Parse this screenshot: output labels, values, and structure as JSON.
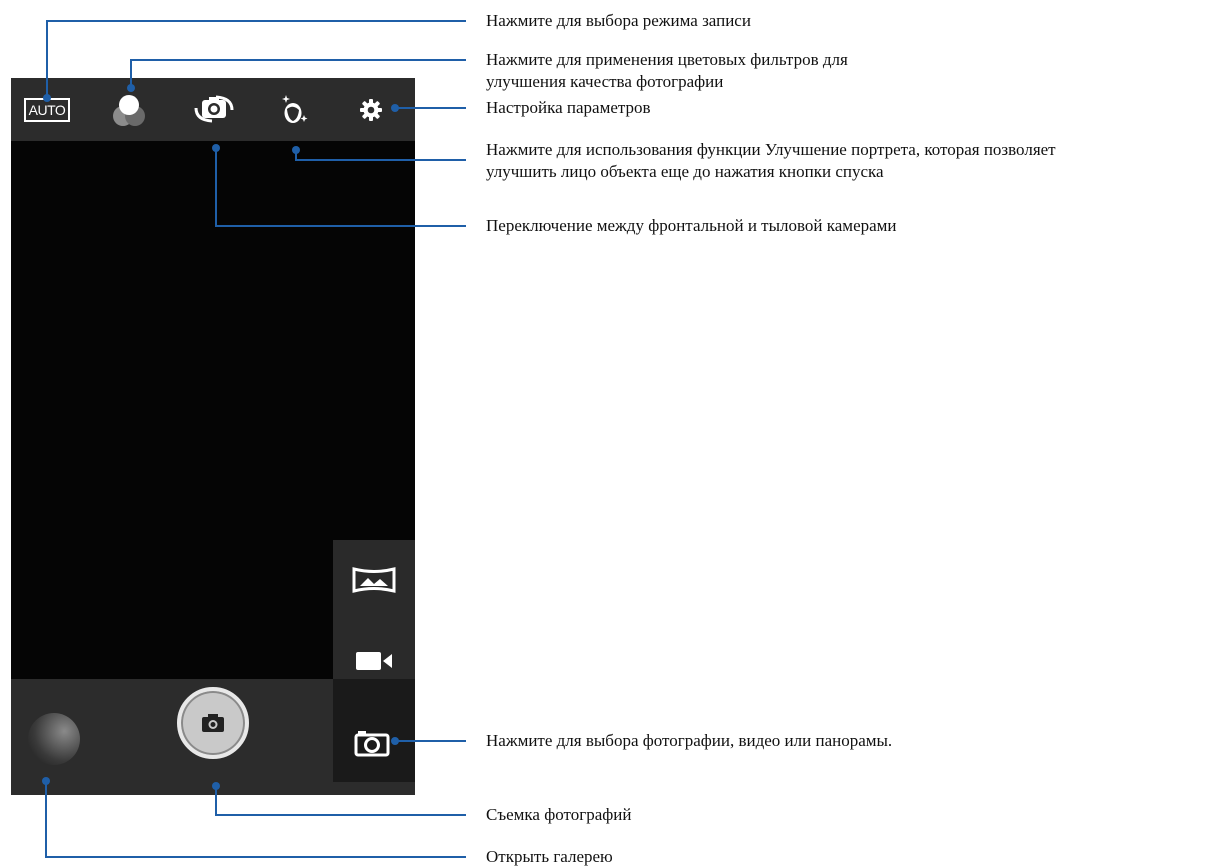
{
  "toolbar": {
    "mode_label": "AUTO",
    "icons": [
      "auto-mode-icon",
      "color-filter-icon",
      "switch-camera-icon",
      "beautification-icon",
      "gear-icon"
    ]
  },
  "side_modes": {
    "icons": [
      "panorama-icon",
      "video-camera-icon",
      "photo-camera-icon"
    ]
  },
  "bottom": {
    "icons": [
      "gallery-thumbnail",
      "shutter-camera-icon"
    ]
  },
  "annotations": {
    "record_mode": "Нажмите для выбора режима записи",
    "color_filters_line1": "Нажмите для применения цветовых фильтров для",
    "color_filters_line2": "улучшения качества фотографии",
    "settings": "Настройка параметров",
    "portrait_line1": "Нажмите для использования функции Улучшение портрета, которая позволяет",
    "portrait_line2": "улучшить лицо объекта еще до нажатия кнопки спуска",
    "switch_camera": "Переключение между фронтальной и тыловой камерами",
    "mode_select": "Нажмите для выбора фотографии, видео или панорамы.",
    "take_photo": "Съемка фотографий",
    "open_gallery": "Открыть галерею"
  },
  "colors": {
    "callout_line": "#1f5fa8",
    "toolbar_bg": "#2c2c2c",
    "viewfinder_bg": "#050505"
  }
}
